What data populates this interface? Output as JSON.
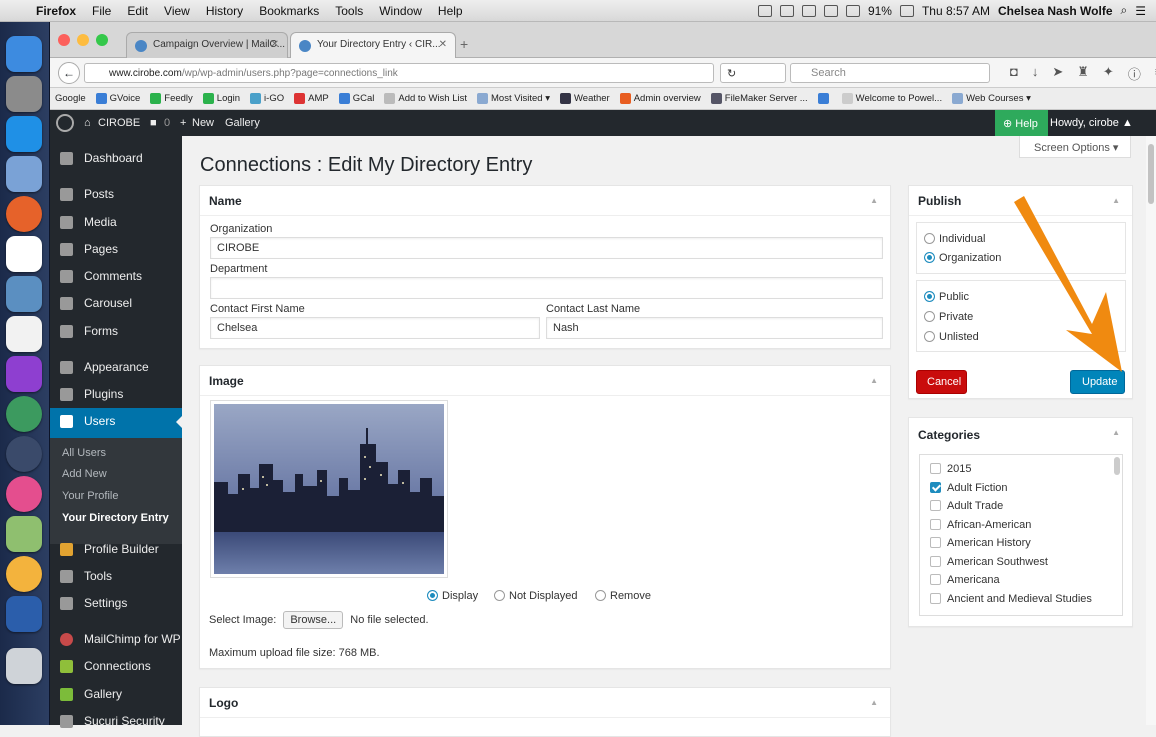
{
  "menubar": {
    "items": [
      "Firefox",
      "File",
      "Edit",
      "View",
      "History",
      "Bookmarks",
      "Tools",
      "Window",
      "Help"
    ],
    "battery": "91%",
    "clock": "Thu 8:57 AM",
    "user": "Chelsea Nash Wolfe"
  },
  "tabs": [
    {
      "label": "Campaign Overview | MailC..."
    },
    {
      "label": "Your Directory Entry ‹ CIR..."
    }
  ],
  "nav": {
    "url_host": "www.cirobe.com",
    "url_path": "/wp/wp-admin/users.php?page=connections_link",
    "search_placeholder": "Search"
  },
  "bookmarks": [
    "Google",
    "GVoice",
    "Feedly",
    "Login",
    "i-GO",
    "AMP",
    "GCal",
    "Add to Wish List",
    "Most Visited ▾",
    "Weather",
    "Admin overview",
    "FileMaker Server ...",
    "Welcome to Powel...",
    "Web Courses ▾"
  ],
  "adminbar": {
    "site": "CIROBE",
    "comments": "0",
    "new": "New",
    "gallery": "Gallery",
    "help": "Help",
    "howdy": "Howdy, cirobe"
  },
  "sidebar": {
    "items": [
      "Dashboard",
      "Posts",
      "Media",
      "Pages",
      "Comments",
      "Carousel",
      "Forms",
      "Appearance",
      "Plugins",
      "Users",
      "Profile Builder",
      "Tools",
      "Settings",
      "MailChimp for WP",
      "Connections",
      "Gallery",
      "Sucuri Security"
    ],
    "submenu": [
      "All Users",
      "Add New",
      "Your Profile",
      "Your Directory Entry"
    ]
  },
  "page": {
    "screen_options": "Screen Options",
    "title": "Connections : Edit My Directory Entry"
  },
  "name_box": {
    "title": "Name",
    "org_label": "Organization",
    "org_value": "CIROBE",
    "dept_label": "Department",
    "dept_value": "",
    "first_label": "Contact First Name",
    "first_value": "Chelsea",
    "last_label": "Contact Last Name",
    "last_value": "Nash"
  },
  "image_box": {
    "title": "Image",
    "opt_display": "Display",
    "opt_not_displayed": "Not Displayed",
    "opt_remove": "Remove",
    "select_label": "Select Image:",
    "browse": "Browse...",
    "no_file": "No file selected.",
    "max_size": "Maximum upload file size: 768 MB."
  },
  "logo_box": {
    "title": "Logo"
  },
  "publish": {
    "title": "Publish",
    "type_individual": "Individual",
    "type_organization": "Organization",
    "vis_public": "Public",
    "vis_private": "Private",
    "vis_unlisted": "Unlisted",
    "cancel": "Cancel",
    "update": "Update"
  },
  "categories": {
    "title": "Categories",
    "items": [
      {
        "label": "2015",
        "checked": false
      },
      {
        "label": "Adult Fiction",
        "checked": true
      },
      {
        "label": "Adult Trade",
        "checked": false
      },
      {
        "label": "African-American",
        "checked": false
      },
      {
        "label": "American History",
        "checked": false
      },
      {
        "label": "American Southwest",
        "checked": false
      },
      {
        "label": "Americana",
        "checked": false
      },
      {
        "label": "Ancient and Medieval Studies",
        "checked": false
      }
    ]
  },
  "colors": {
    "admin_dark": "#23282d",
    "wp_blue": "#0073aa",
    "cancel_red": "#c90c0c",
    "annotation_arrow": "#f08a10"
  }
}
